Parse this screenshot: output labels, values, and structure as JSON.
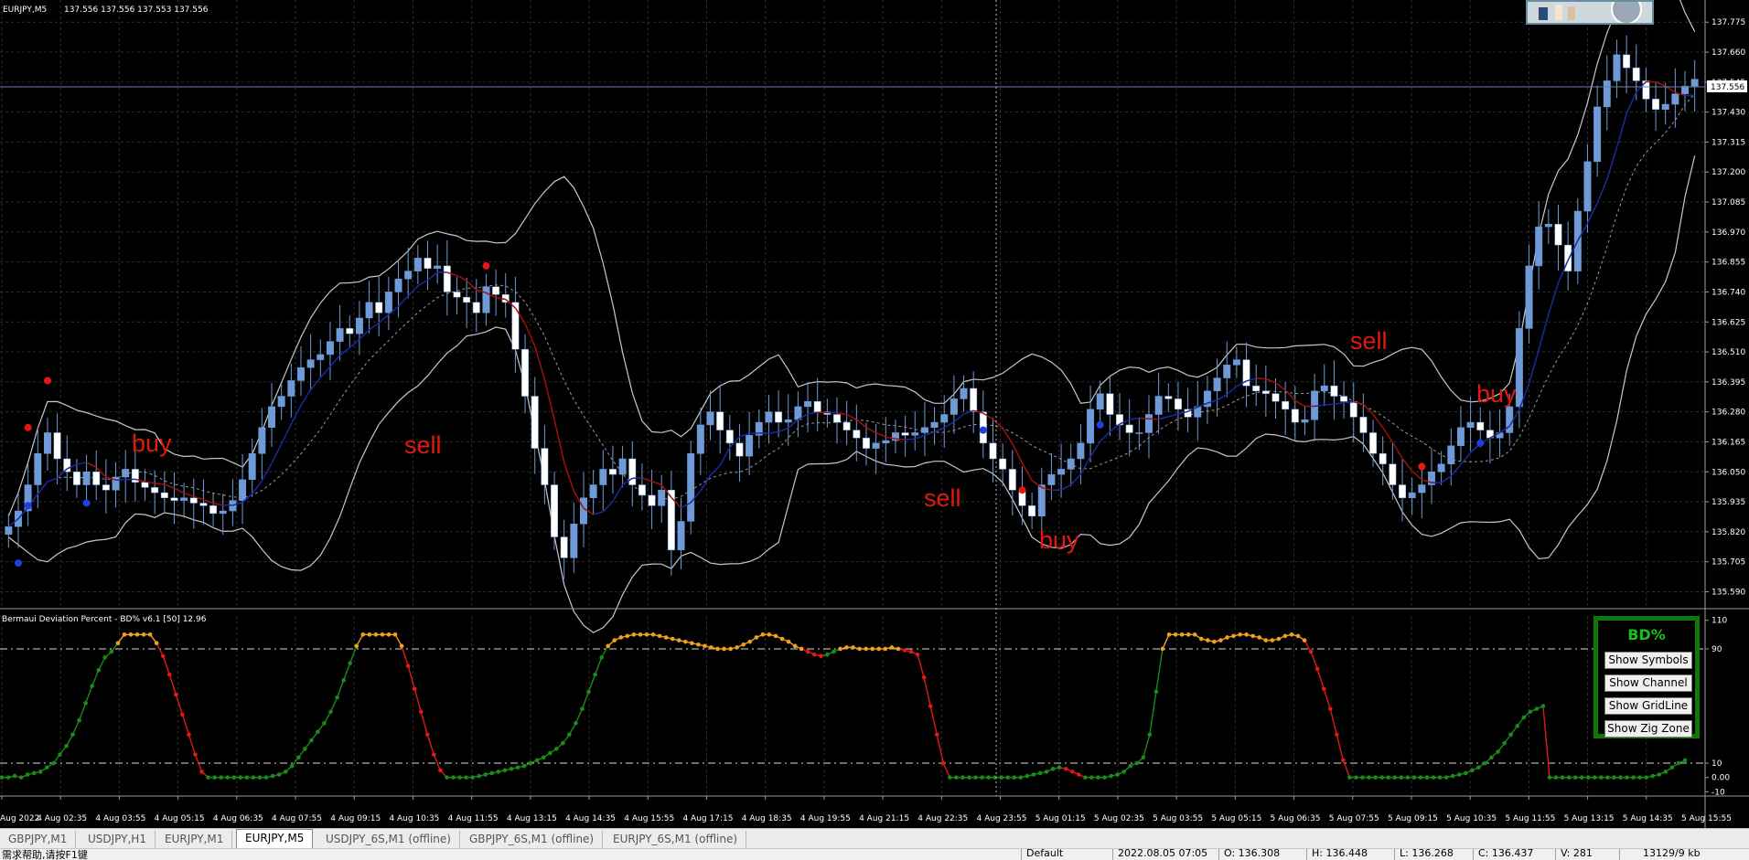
{
  "main_chart": {
    "title": "EURJPY,M5",
    "ohlc": "137.556 137.556 137.553 137.556",
    "current_price": "137.556",
    "price_levels": [
      "137.775",
      "137.660",
      "137.545",
      "137.430",
      "137.315",
      "137.200",
      "137.085",
      "136.970",
      "136.855",
      "136.740",
      "136.625",
      "136.510",
      "136.395",
      "136.280",
      "136.165",
      "136.050",
      "135.935",
      "135.820",
      "135.705",
      "135.590"
    ],
    "signals": [
      {
        "label": "buy"
      },
      {
        "label": "sell"
      },
      {
        "label": "sell"
      },
      {
        "label": "buy"
      },
      {
        "label": "sell"
      },
      {
        "label": "buy"
      }
    ]
  },
  "time_axis": [
    "Aug 2022",
    "4 Aug 02:35",
    "4 Aug 03:55",
    "4 Aug 05:15",
    "4 Aug 06:35",
    "4 Aug 07:55",
    "4 Aug 09:15",
    "4 Aug 10:35",
    "4 Aug 11:55",
    "4 Aug 13:15",
    "4 Aug 14:35",
    "4 Aug 15:55",
    "4 Aug 17:15",
    "4 Aug 18:35",
    "4 Aug 19:55",
    "4 Aug 21:15",
    "4 Aug 22:35",
    "4 Aug 23:55",
    "5 Aug 01:15",
    "5 Aug 02:35",
    "5 Aug 03:55",
    "5 Aug 05:15",
    "5 Aug 06:35",
    "5 Aug 07:55",
    "5 Aug 09:15",
    "5 Aug 10:35",
    "5 Aug 11:55",
    "5 Aug 13:15",
    "5 Aug 14:35",
    "5 Aug 15:55"
  ],
  "indicator": {
    "title": "Bermaui Deviation Percent - BD% v6.1 [50] 12.96",
    "levels": [
      "110",
      "90",
      "10",
      "0.00",
      "-10"
    ],
    "panel": {
      "title": "BD%",
      "buttons": [
        "Show Symbols",
        "Show Channel",
        "Show GridLine",
        "Show Zig Zone"
      ]
    }
  },
  "tabs": [
    {
      "label": "GBPJPY,M1",
      "active": false
    },
    {
      "label": "USDJPY,H1",
      "active": false
    },
    {
      "label": "EURJPY,M1",
      "active": false
    },
    {
      "label": "EURJPY,M5",
      "active": true
    },
    {
      "label": "USDJPY_6S,M1 (offline)",
      "active": false
    },
    {
      "label": "GBPJPY_6S,M1 (offline)",
      "active": false
    },
    {
      "label": "EURJPY_6S,M1 (offline)",
      "active": false
    }
  ],
  "status": {
    "help": "需求帮助,请按F1键",
    "profile": "Default",
    "datetime": "2022.08.05 07:05",
    "open": "O: 136.308",
    "high": "H: 136.448",
    "low": "L: 136.268",
    "close": "C: 136.437",
    "volume": "V: 281",
    "traffic": "13129/9 kb"
  },
  "colors": {
    "background": "#000000",
    "candle": "#6f9ad8",
    "band": "#c8c8c8",
    "signal_text": "#e3190f",
    "bd_green": "#1a8a1a",
    "bd_red": "#e01818",
    "bd_orange": "#f0a020",
    "panel_border": "#0b7a0b"
  },
  "series": {
    "price_close": [
      135.84,
      135.9,
      136.0,
      136.12,
      136.2,
      136.1,
      136.05,
      136.0,
      136.05,
      136.0,
      135.98,
      136.03,
      136.06,
      136.01,
      135.99,
      135.97,
      135.95,
      135.94,
      135.95,
      135.93,
      135.92,
      135.89,
      135.9,
      135.94,
      136.02,
      136.12,
      136.22,
      136.3,
      136.34,
      136.4,
      136.45,
      136.48,
      136.5,
      136.55,
      136.6,
      136.58,
      136.64,
      136.7,
      136.66,
      136.74,
      136.79,
      136.82,
      136.87,
      136.83,
      136.84,
      136.74,
      136.72,
      136.7,
      136.66,
      136.76,
      136.73,
      136.7,
      136.52,
      136.34,
      136.14,
      136.0,
      135.8,
      135.72,
      135.85,
      135.95,
      136.0,
      136.06,
      136.04,
      136.1,
      136.0,
      135.96,
      135.92,
      135.98,
      135.75,
      135.86,
      136.12,
      136.23,
      136.28,
      136.21,
      136.16,
      136.11,
      136.19,
      136.24,
      136.28,
      136.24,
      136.25,
      136.3,
      136.32,
      136.28,
      136.27,
      136.24,
      136.21,
      136.18,
      136.14,
      136.16,
      136.17,
      136.2,
      136.19,
      136.2,
      136.22,
      136.24,
      136.27,
      136.33,
      136.37,
      136.28,
      136.16,
      136.1,
      136.06,
      135.98,
      135.92,
      135.88,
      136.0,
      136.04,
      136.06,
      136.1,
      136.16,
      136.29,
      136.35,
      136.27,
      136.23,
      136.2,
      136.2,
      136.27,
      136.34,
      136.33,
      136.29,
      136.26,
      136.3,
      136.36,
      136.41,
      136.46,
      136.48,
      136.38,
      136.36,
      136.35,
      136.32,
      136.29,
      136.24,
      136.25,
      136.36,
      136.38,
      136.34,
      136.32,
      136.26,
      136.2,
      136.12,
      136.08,
      136.0,
      135.95,
      135.97,
      136.0,
      136.05,
      136.08,
      136.15,
      136.22,
      136.24,
      136.21,
      136.18,
      136.2,
      136.3,
      136.6,
      136.84,
      136.99,
      137.0,
      136.92,
      136.82,
      137.05,
      137.24,
      137.45,
      137.55,
      137.65,
      137.6,
      137.55,
      137.48,
      137.44,
      137.46,
      137.5,
      137.53,
      137.556
    ],
    "bd": [
      0,
      0,
      1,
      0,
      2,
      3,
      4,
      7,
      10,
      16,
      22,
      30,
      40,
      52,
      64,
      75,
      84,
      88,
      94,
      100,
      100,
      100,
      100,
      100,
      94,
      85,
      72,
      58,
      44,
      30,
      16,
      4,
      0,
      0,
      0,
      0,
      0,
      0,
      0,
      0,
      0,
      0,
      1,
      2,
      4,
      8,
      14,
      20,
      26,
      32,
      38,
      46,
      56,
      68,
      80,
      92,
      100,
      100,
      100,
      100,
      100,
      100,
      92,
      78,
      62,
      46,
      30,
      16,
      5,
      0,
      0,
      0,
      0,
      0,
      1,
      2,
      3,
      4,
      5,
      6,
      7,
      8,
      10,
      12,
      14,
      17,
      20,
      24,
      30,
      38,
      48,
      60,
      72,
      84,
      92,
      96,
      98,
      99,
      100,
      100,
      100,
      100,
      99,
      98,
      97,
      96,
      95,
      94,
      93,
      92,
      91,
      90,
      90,
      90,
      91,
      93,
      95,
      98,
      100,
      100,
      99,
      97,
      95,
      92,
      90,
      88,
      86,
      85,
      86,
      88,
      90,
      91,
      91,
      90,
      90,
      90,
      90,
      90,
      91,
      90,
      89,
      88,
      86,
      70,
      50,
      30,
      10,
      0,
      0,
      0,
      0,
      0,
      0,
      0,
      0,
      0,
      0,
      0,
      0,
      1,
      2,
      3,
      4,
      6,
      7,
      6,
      4,
      2,
      0,
      0,
      0,
      0,
      1,
      2,
      4,
      8,
      10,
      14,
      30,
      60,
      90,
      100,
      100,
      100,
      100,
      100,
      97,
      96,
      95,
      96,
      98,
      99,
      100,
      100,
      99,
      98,
      96,
      96,
      97,
      99,
      100,
      99,
      96,
      88,
      76,
      62,
      48,
      30,
      12,
      0,
      0,
      0,
      0,
      0,
      0,
      0,
      0,
      0,
      0,
      0,
      0,
      0,
      0,
      0,
      0,
      1,
      2,
      3,
      5,
      7,
      10,
      14,
      18,
      24,
      30,
      36,
      42,
      46,
      48,
      50,
      0,
      0,
      0,
      0,
      0,
      0,
      0,
      0,
      0,
      0,
      0,
      0,
      0,
      0,
      0,
      0,
      1,
      2,
      4,
      7,
      10,
      12
    ]
  }
}
